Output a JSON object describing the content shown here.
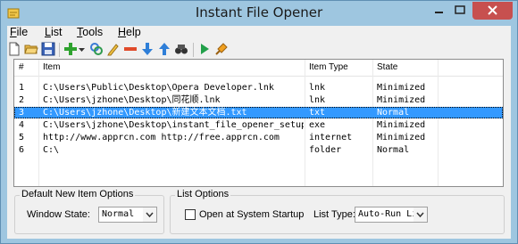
{
  "window": {
    "title": "Instant File Opener"
  },
  "menu": [
    {
      "label": "File"
    },
    {
      "label": "List"
    },
    {
      "label": "Tools"
    },
    {
      "label": "Help"
    }
  ],
  "toolbar": [
    "new-icon",
    "open-folder-icon",
    "save-icon",
    "add-icon",
    "dropdown-arrow-icon",
    "link-icon",
    "edit-icon",
    "remove-icon",
    "move-down-icon",
    "move-up-icon",
    "find-icon",
    "run-icon",
    "clear-icon"
  ],
  "list": {
    "columns": {
      "num": "#",
      "item": "Item",
      "type": "Item Type",
      "state": "State"
    },
    "rows": [
      {
        "num": "1",
        "item": "C:\\Users\\Public\\Desktop\\Opera Developer.lnk",
        "type": "lnk",
        "state": "Minimized"
      },
      {
        "num": "2",
        "item": "C:\\Users\\jzhone\\Desktop\\同花顺.lnk",
        "type": "lnk",
        "state": "Minimized"
      },
      {
        "num": "3",
        "item": "C:\\Users\\jzhone\\Desktop\\新建文本文档.txt",
        "type": "txt",
        "state": "Normal",
        "selected": true
      },
      {
        "num": "4",
        "item": "C:\\Users\\jzhone\\Desktop\\instant_file_opener_setup.exe",
        "type": "exe",
        "state": "Minimized"
      },
      {
        "num": "5",
        "item": "http://www.apprcn.com http://free.apprcn.com",
        "type": "internet",
        "state": "Minimized"
      },
      {
        "num": "6",
        "item": "C:\\",
        "type": "folder",
        "state": "Normal"
      }
    ]
  },
  "defaults_group": {
    "title": "Default New Item Options",
    "window_state_label": "Window State:",
    "window_state_value": "Normal"
  },
  "list_options_group": {
    "title": "List Options",
    "startup_label": "Open at System Startup",
    "startup_checked": false,
    "list_type_label": "List Type:",
    "list_type_value": "Auto-Run Li:"
  },
  "colors": {
    "accent": "#3399ff",
    "close": "#c7504f",
    "frame": "#9ec6e0"
  }
}
